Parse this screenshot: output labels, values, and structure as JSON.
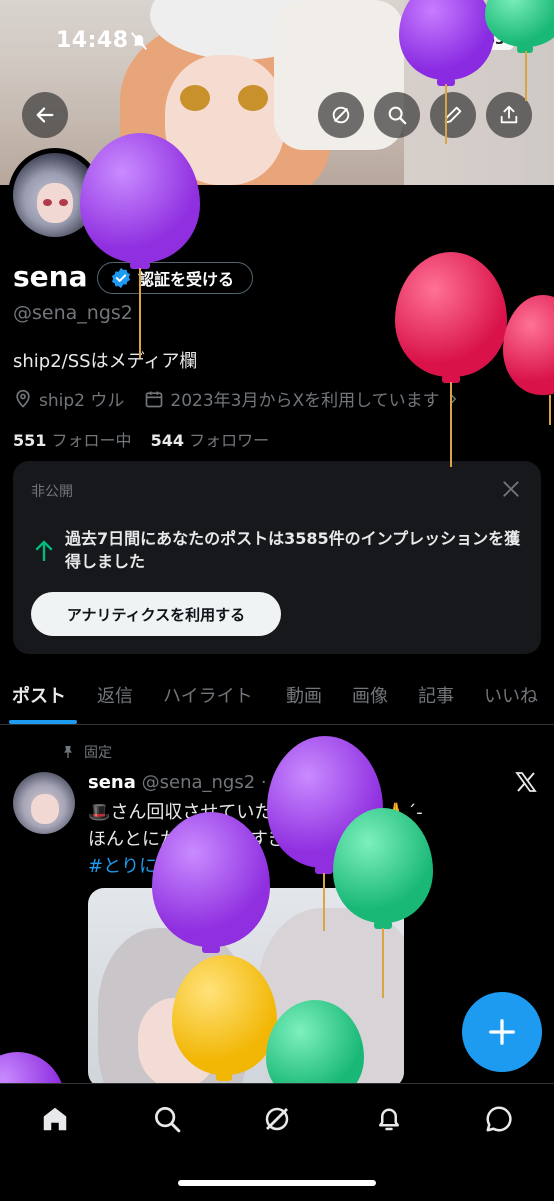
{
  "status_bar": {
    "time": "14:48",
    "battery": "63"
  },
  "profile": {
    "name": "sena",
    "verify_label": "認証を受ける",
    "handle": "@sena_ngs2",
    "bio": "ship2/SSはメディア欄",
    "location": "ship2 ウル",
    "joined": "2023年3月からXを利用しています",
    "following_count": "551",
    "following_label": "フォロー中",
    "followers_count": "544",
    "followers_label": "フォロワー"
  },
  "private_card": {
    "label": "非公開",
    "message": "過去7日間にあなたのポストは3585件のインプレッションを獲得しました",
    "button": "アナリティクスを利用する"
  },
  "tabs": [
    "ポスト",
    "返信",
    "ハイライト",
    "動画",
    "画像",
    "記事",
    "いいね"
  ],
  "post": {
    "pinned_label": "固定",
    "author": "sena",
    "handle_time": "@sena_ngs2 · 22 時間",
    "line1": "🎩さん回収させていただきました‼️🙏´-",
    "line2": "ほんとにかわいいがすぎる…",
    "hashtag": "#とりにきた"
  },
  "colors": {
    "accent": "#1d9bf0",
    "balloon_purple": "#9b30e0",
    "balloon_red": "#e0164a",
    "balloon_green": "#22c98a",
    "balloon_yellow": "#f5c11c"
  }
}
